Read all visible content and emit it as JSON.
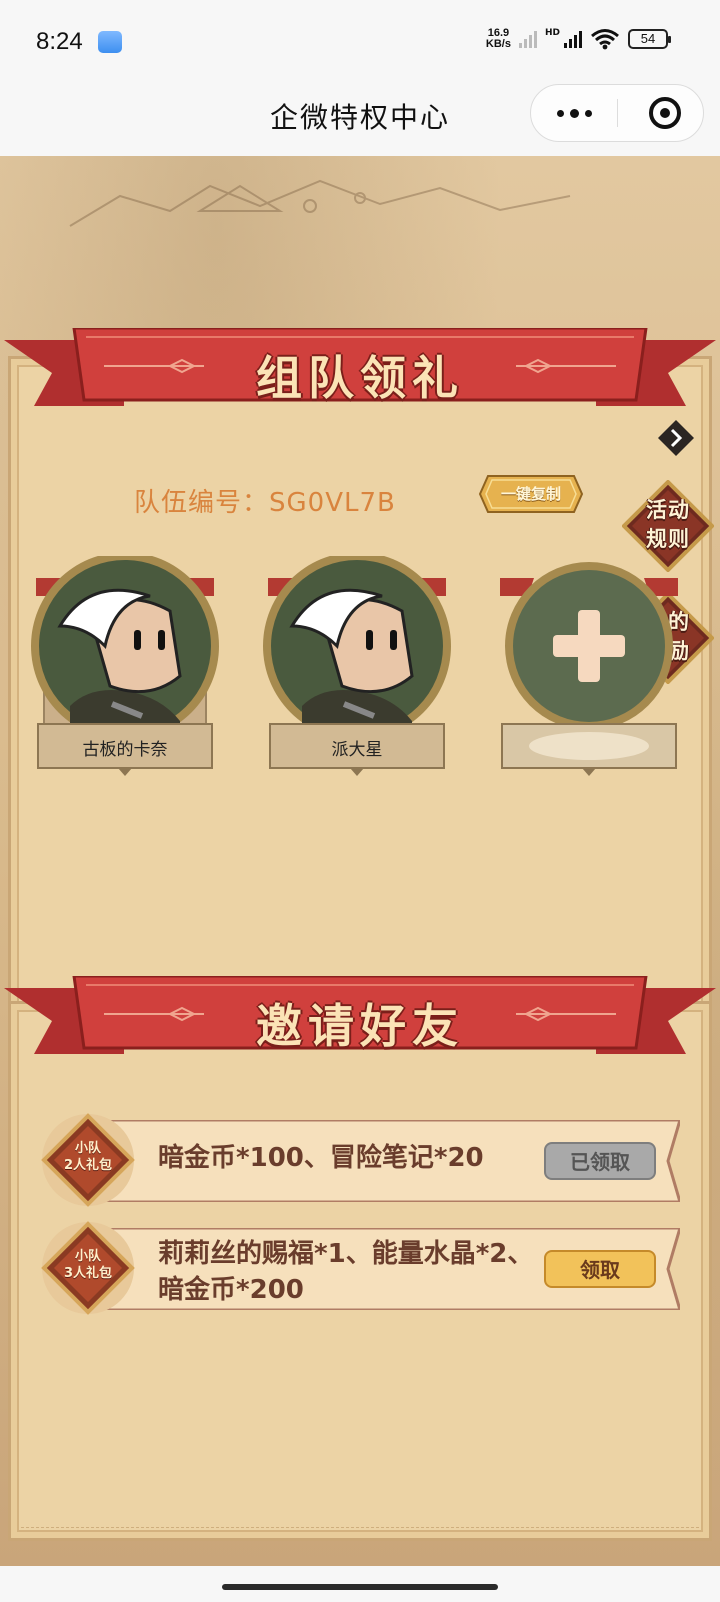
{
  "status_bar": {
    "time": "8:24",
    "net_speed_value": "16.9",
    "net_speed_unit": "KB/s",
    "hd_label": "HD",
    "battery": "54"
  },
  "title_bar": {
    "title": "企微特权中心",
    "more_icon": "more-dots-icon",
    "close_icon": "mini-program-close-icon"
  },
  "team_section": {
    "banner_title": "组队领礼",
    "team_number_label": "队伍编号：SG0VL7B",
    "copy_button": "一键复制",
    "rules_button": "活动\n规则",
    "rewards_button": "我的\n奖励",
    "members": [
      {
        "name": "古板的卡奈",
        "avatar": "character-avatar"
      },
      {
        "name": "派大星",
        "avatar": "character-avatar"
      },
      {
        "name": "",
        "avatar": "add-member-plus-icon"
      }
    ]
  },
  "invite_section": {
    "banner_title": "邀请好友",
    "gifts": [
      {
        "badge_line1": "小队",
        "badge_line2": "2人礼包",
        "reward": "暗金币*100、冒险笔记*20",
        "button": "已领取",
        "state": "claimed"
      },
      {
        "badge_line1": "小队",
        "badge_line2": "3人礼包",
        "reward_line1": "莉莉丝的赐福*1、能量水晶*2、",
        "reward_line2": "暗金币*200",
        "button": "领取",
        "state": "available"
      }
    ]
  },
  "colors": {
    "ribbon_red": "#c8383a",
    "panel_bg": "#ecd3a5",
    "team_number": "#d9843e",
    "claim_active": "#f2c25a",
    "claim_done": "#a9a9a9"
  }
}
